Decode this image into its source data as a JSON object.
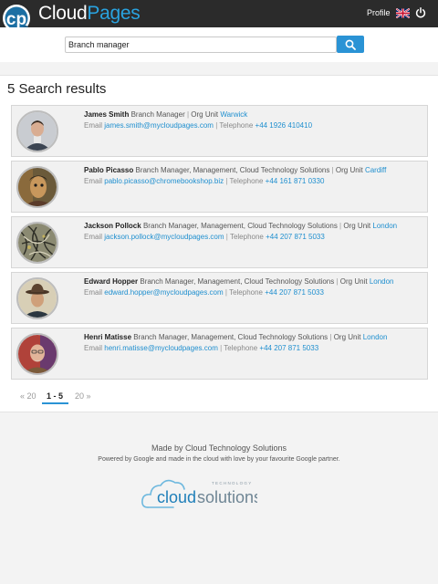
{
  "header": {
    "brand_part1": "Cloud",
    "brand_part2": "Pages",
    "profile_label": "Profile",
    "icons": [
      "logo-magnifier-icon",
      "uk-flag-icon",
      "power-icon"
    ],
    "brand_color": "#29a3e0"
  },
  "search": {
    "value": "Branch manager",
    "button_icon": "search-icon"
  },
  "results": {
    "title": "5 Search results",
    "org_unit_label": "Org Unit",
    "email_label": "Email",
    "telephone_label": "Telephone",
    "items": [
      {
        "name": "James Smith",
        "role": "Branch Manager",
        "org_unit": "Warwick",
        "email": "james.smith@mycloudpages.com",
        "telephone": "+44 1926 410410"
      },
      {
        "name": "Pablo Picasso",
        "role": "Branch Manager, Management, Cloud Technology Solutions",
        "org_unit": "Cardiff",
        "email": "pablo.picasso@chromebookshop.biz",
        "telephone": "+44 161 871 0330"
      },
      {
        "name": "Jackson Pollock",
        "role": "Branch Manager, Management, Cloud Technology Solutions",
        "org_unit": "London",
        "email": "jackson.pollock@mycloudpages.com",
        "telephone": "+44 207 871 5033"
      },
      {
        "name": "Edward Hopper",
        "role": "Branch Manager, Management, Cloud Technology Solutions",
        "org_unit": "London",
        "email": "edward.hopper@mycloudpages.com",
        "telephone": "+44 207 871 5033"
      },
      {
        "name": "Henri Matisse",
        "role": "Branch Manager, Management, Cloud Technology Solutions",
        "org_unit": "London",
        "email": "henri.matisse@mycloudpages.com",
        "telephone": "+44 207 871 5033"
      }
    ]
  },
  "pagination": {
    "prev": "« 20",
    "current": "1 - 5",
    "next": "20 »"
  },
  "footer": {
    "made_by": "Made by Cloud Technology Solutions",
    "powered_by": "Powered by Google and made in the cloud with love by your favourite Google partner.",
    "logo_word1": "cloud",
    "logo_word2": "solutions",
    "logo_tagline": "TECHNOLOGY"
  }
}
